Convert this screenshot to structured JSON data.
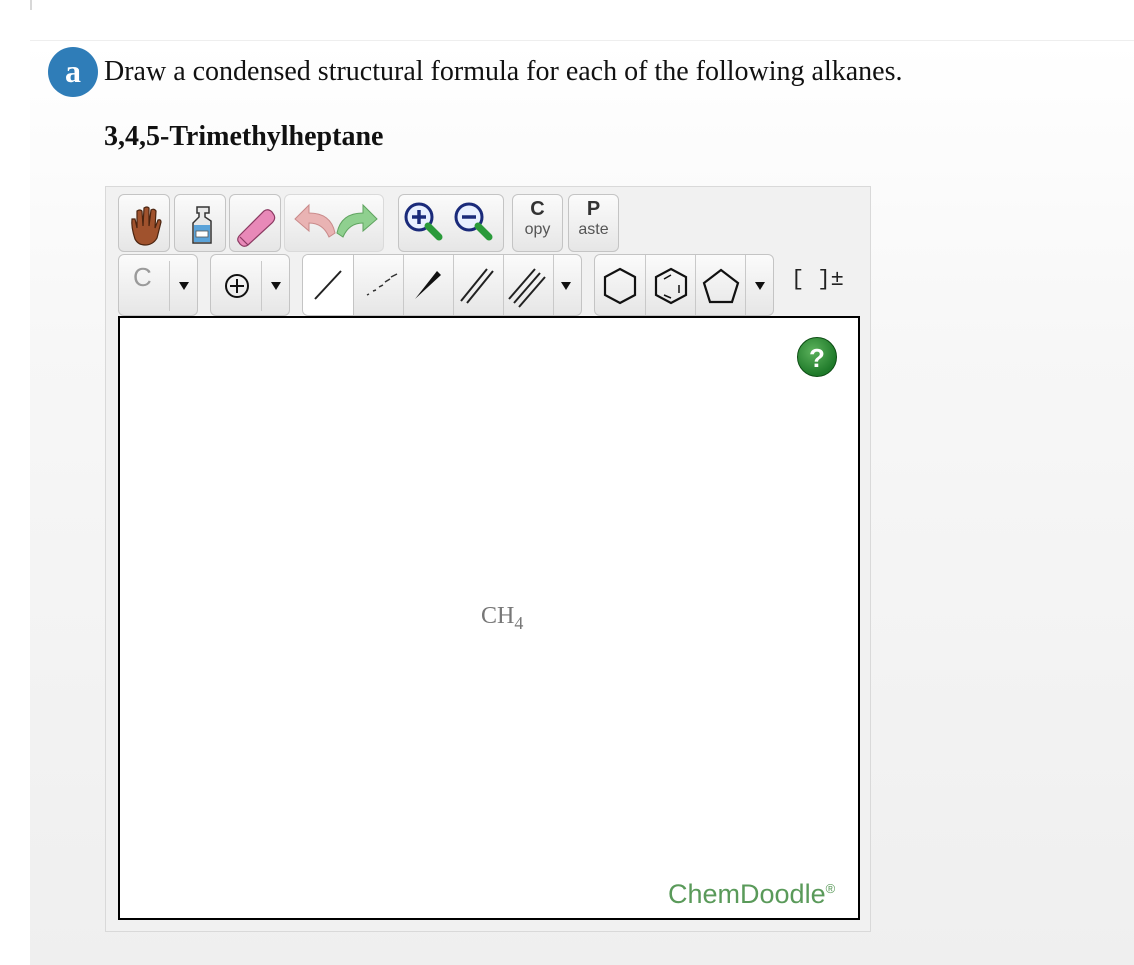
{
  "question": {
    "badge": "a",
    "prompt": "Draw a condensed structural formula for each of the following alkanes.",
    "compound": "3,4,5-Trimethylheptane"
  },
  "toolbar": {
    "row1": [
      {
        "name": "hand-tool",
        "icon": "hand-icon"
      },
      {
        "name": "clear-tool",
        "icon": "spray-bottle-icon"
      },
      {
        "name": "eraser-tool",
        "icon": "eraser-icon"
      },
      {
        "name": "undo",
        "icon": "undo-arrow-icon"
      },
      {
        "name": "redo",
        "icon": "redo-arrow-icon"
      },
      {
        "name": "zoom-in",
        "icon": "zoom-in-icon"
      },
      {
        "name": "zoom-out",
        "icon": "zoom-out-icon"
      }
    ],
    "copy": {
      "big": "C",
      "small": "opy"
    },
    "paste": {
      "big": "P",
      "small": "aste"
    },
    "row2": {
      "atom_label": "C",
      "charge_icon": "plus-charge-icon",
      "bonds": [
        "single-bond-icon",
        "dashed-bond-icon",
        "wedge-bond-icon",
        "double-bond-icon",
        "triple-bond-icon"
      ],
      "rings": [
        "cyclohexane-icon",
        "benzene-icon",
        "cyclopentane-icon"
      ],
      "bracket_label": "[ ]±"
    }
  },
  "canvas": {
    "help_label": "?",
    "molecule_main": "CH",
    "molecule_sub": "4",
    "brand": "ChemDoodle",
    "brand_mark": "®"
  },
  "colors": {
    "badge": "#2f7db8",
    "help": "#1f7a2a",
    "brand": "#5a9a5a",
    "eraser": "#e889b8",
    "undo": "#e0a0a0",
    "redo": "#8fd08f",
    "zoom_handle": "#2a9a3a"
  }
}
